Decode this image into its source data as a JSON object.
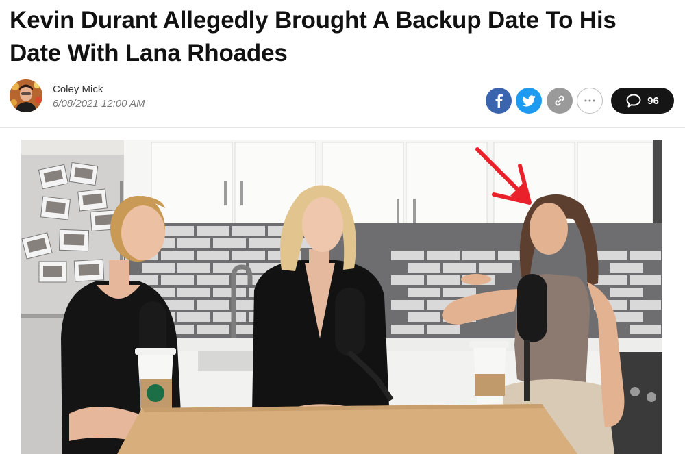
{
  "article": {
    "title": "Kevin Durant Allegedly Brought A Backup Date To His Date With Lana Rhoades",
    "author": "Coley Mick",
    "date": "6/08/2021 12:00 AM",
    "comment_count": "96"
  },
  "share": {
    "facebook_icon": "facebook-icon",
    "twitter_icon": "twitter-icon",
    "link_icon": "link-icon",
    "more_icon": "more-icon",
    "comment_icon": "comment-bubble-icon"
  },
  "colors": {
    "facebook": "#3b64ae",
    "twitter": "#1d9bf0",
    "link": "#9a9a9a",
    "comments_bg": "#151515",
    "arrow": "#e8212b"
  }
}
